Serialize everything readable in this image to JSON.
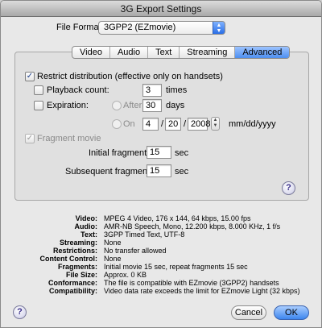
{
  "window": {
    "title": "3G Export Settings"
  },
  "format": {
    "label": "File Format:",
    "value": "3GPP2 (EZmovie)"
  },
  "tabs": [
    {
      "label": "Video"
    },
    {
      "label": "Audio"
    },
    {
      "label": "Text"
    },
    {
      "label": "Streaming"
    },
    {
      "label": "Advanced"
    }
  ],
  "advanced": {
    "restrict": {
      "label": "Restrict distribution (effective only on handsets)",
      "checked": true
    },
    "playback": {
      "label": "Playback count:",
      "value": "3",
      "unit": "times",
      "checked": false
    },
    "expiration": {
      "label": "Expiration:",
      "checked": false,
      "after_label": "After",
      "after_value": "30",
      "after_unit": "days",
      "on_label": "On",
      "month": "4",
      "day": "20",
      "year": "2008",
      "sep1": "/",
      "sep2": "/",
      "date_format": "mm/dd/yyyy"
    },
    "fragment": {
      "label": "Fragment movie",
      "checked": true,
      "initial_label": "Initial fragment:",
      "initial_value": "15",
      "initial_unit": "sec",
      "subsequent_label": "Subsequent fragments:",
      "subsequent_value": "15",
      "subsequent_unit": "sec"
    }
  },
  "summary": [
    {
      "key": "Video:",
      "value": "MPEG 4 Video, 176 x 144, 64 kbps, 15.00 fps"
    },
    {
      "key": "Audio:",
      "value": "AMR-NB Speech, Mono, 12.200 kbps, 8.000 KHz, 1 f/s"
    },
    {
      "key": "Text:",
      "value": "3GPP Timed Text, UTF-8"
    },
    {
      "key": "Streaming:",
      "value": "None"
    },
    {
      "key": "Restrictions:",
      "value": "No transfer allowed"
    },
    {
      "key": "Content Control:",
      "value": "None"
    },
    {
      "key": "Fragments:",
      "value": "Initial movie 15 sec, repeat fragments 15 sec"
    },
    {
      "key": "File Size:",
      "value": "Approx. 0 KB"
    },
    {
      "key": "Conformance:",
      "value": "The file is compatible with EZmovie (3GPP2) handsets"
    },
    {
      "key": "Compatibility:",
      "value": "Video data rate exceeds the limit for EZmovie Light (32 kbps)"
    }
  ],
  "buttons": {
    "help": "?",
    "cancel": "Cancel",
    "ok": "OK"
  }
}
